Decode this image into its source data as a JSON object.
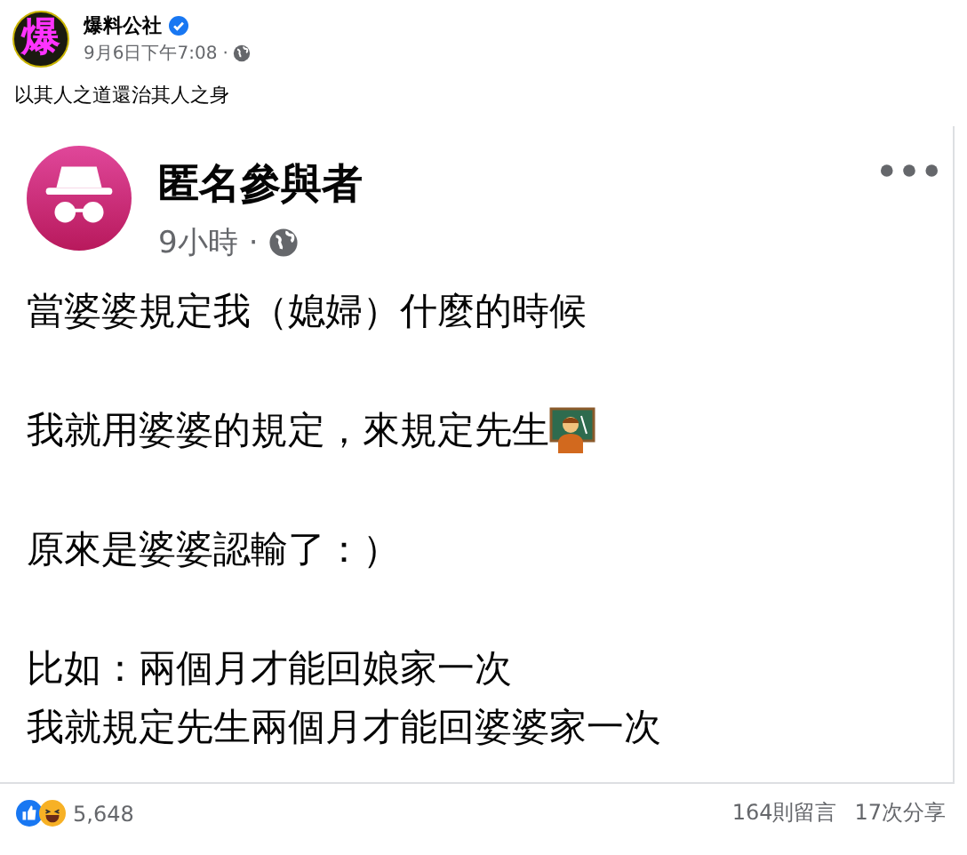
{
  "post": {
    "page_name": "爆料公社",
    "avatar_text": "爆",
    "verified": true,
    "time": "9月6日下午7:08",
    "separator": "·",
    "caption": "以其人之道還治其人之身"
  },
  "shared": {
    "author": "匿名參與者",
    "time": "9小時",
    "separator": "·",
    "paragraphs": [
      {
        "lines": [
          "當婆婆規定我（媳婦）什麼的時候"
        ],
        "emoji": false
      },
      {
        "lines": [
          "我就用婆婆的規定，來規定先生"
        ],
        "emoji": true
      },
      {
        "lines": [
          "原來是婆婆認輸了：）"
        ],
        "emoji": false
      },
      {
        "lines": [
          "比如：兩個月才能回娘家一次",
          "我就規定先生兩個月才能回婆婆家一次"
        ],
        "emoji": false
      }
    ]
  },
  "footer": {
    "reactions": "5,648",
    "comments": "164則留言",
    "shares": "17次分享"
  }
}
